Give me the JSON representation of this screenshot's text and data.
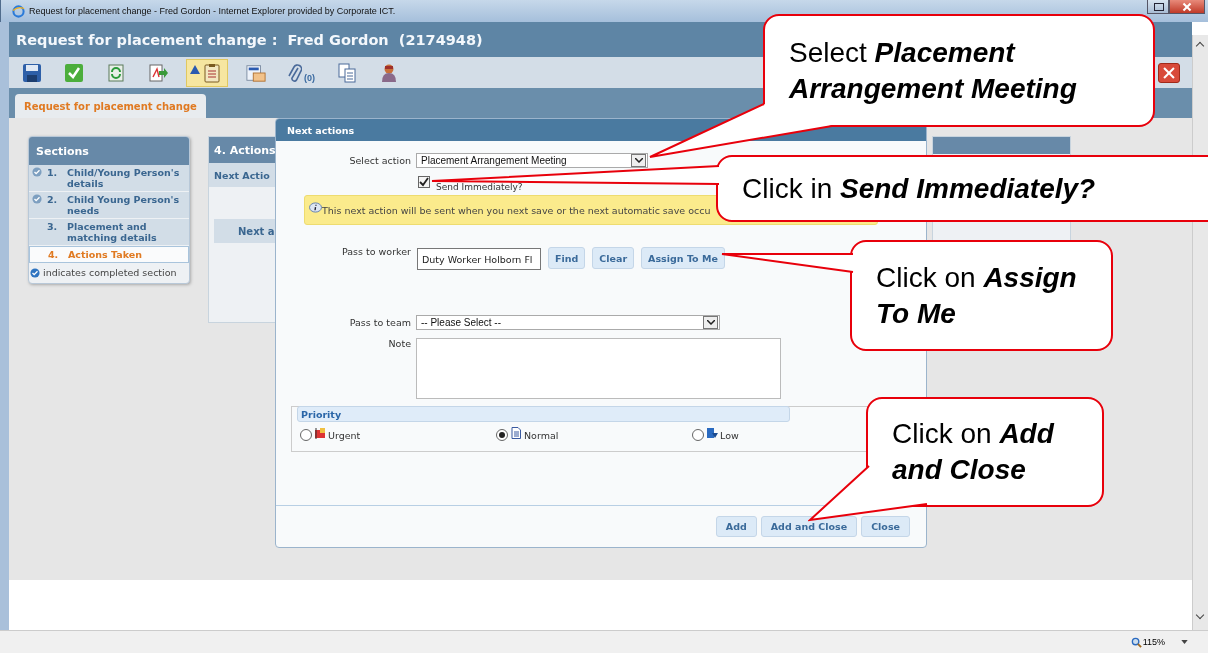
{
  "browser": {
    "title": "Request for placement change - Fred Gordon - Internet Explorer provided by Corporate ICT."
  },
  "header": {
    "title": "Request for placement change :  Fred Gordon  (2174948)"
  },
  "toolbar": [
    {
      "kind": "save",
      "highlighted": false
    },
    {
      "kind": "complete",
      "highlighted": false
    },
    {
      "kind": "refresh",
      "highlighted": false
    },
    {
      "kind": "pdf",
      "highlighted": false
    },
    {
      "kind": "warnings",
      "highlighted": true
    },
    {
      "kind": "letter",
      "highlighted": false
    },
    {
      "kind": "attach",
      "highlighted": false,
      "count": "(0)"
    },
    {
      "kind": "copy",
      "highlighted": false
    },
    {
      "kind": "person",
      "highlighted": false
    }
  ],
  "tabs": [
    {
      "label": "Request for placement change",
      "selected": true
    }
  ],
  "sections": {
    "title": "Sections",
    "legend": "indicates completed section",
    "items": [
      {
        "number": "1.",
        "label": "Child/Young Person's details",
        "completed": true,
        "selected": false
      },
      {
        "number": "2.",
        "label": "Child Young Person's needs",
        "completed": true,
        "selected": false
      },
      {
        "number": "3.",
        "label": "Placement and matching details",
        "completed": false,
        "selected": false
      },
      {
        "number": "4.",
        "label": "Actions Taken",
        "completed": false,
        "selected": true
      }
    ]
  },
  "actions_panel": {
    "title": "4. Actions",
    "subtitle": "Next Actio",
    "button": "Next a"
  },
  "dialog": {
    "title": "Next actions",
    "select_action": {
      "label": "Select action",
      "value": "Placement Arrangement Meeting"
    },
    "send_immediately": {
      "label": "Send Immediately?",
      "checked": true
    },
    "info": "This next action will be sent when you next save or the next automatic save occu",
    "pass_to_worker": {
      "label": "Pass to worker",
      "value": "Duty Worker Holborn Fl"
    },
    "worker_buttons": [
      "Find",
      "Clear",
      "Assign To Me"
    ],
    "pass_to_team": {
      "label": "Pass to team",
      "value": "-- Please Select --"
    },
    "note": {
      "label": "Note"
    },
    "priority": {
      "title": "Priority",
      "options": [
        {
          "label": "Urgent",
          "kind": "urgent",
          "selected": false
        },
        {
          "label": "Normal",
          "kind": "normal",
          "selected": true
        },
        {
          "label": "Low",
          "kind": "low",
          "selected": false
        }
      ]
    },
    "buttons": [
      "Add",
      "Add and Close",
      "Close"
    ]
  },
  "callouts": [
    {
      "text": "Select",
      "emphasis": "Placement Arrangement Meeting"
    },
    {
      "text": "Click in",
      "emphasis": "Send Immediately?"
    },
    {
      "text": "Click on",
      "emphasis": "Assign To Me"
    },
    {
      "text": "Click on",
      "emphasis": "Add and Close"
    }
  ],
  "status_bar": {
    "zoom": "115%"
  }
}
